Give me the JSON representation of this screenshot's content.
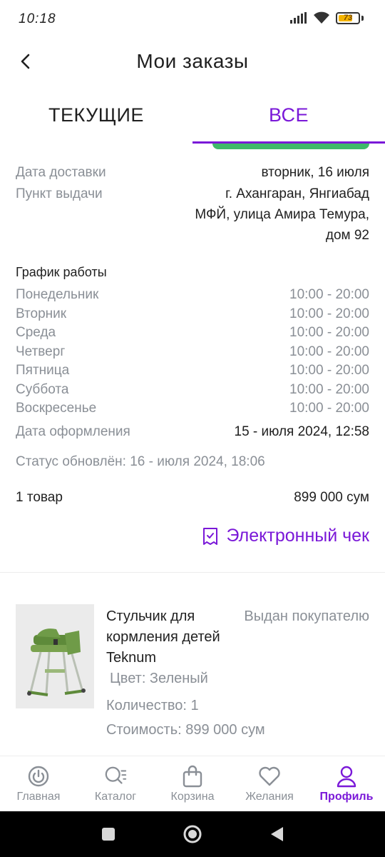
{
  "status_bar": {
    "time": "10:18",
    "battery": "73",
    "battery_level": 0.73
  },
  "header": {
    "title": "Мои заказы"
  },
  "tabs": [
    {
      "label": "ТЕКУЩИЕ",
      "active": false
    },
    {
      "label": "ВСЕ",
      "active": true
    }
  ],
  "delivery": {
    "date_label": "Дата доставки",
    "date_value": "вторник, 16 июля",
    "pickup_label": "Пункт выдачи",
    "pickup_lines": [
      "г. Ахангаран, Янгиабад",
      "МФЙ, улица Амира Темура,",
      "дом 92"
    ]
  },
  "schedule": {
    "title": "График работы",
    "days": [
      {
        "day": "Понедельник",
        "hours": "10:00 - 20:00"
      },
      {
        "day": "Вторник",
        "hours": "10:00 - 20:00"
      },
      {
        "day": "Среда",
        "hours": "10:00 - 20:00"
      },
      {
        "day": "Четверг",
        "hours": "10:00 - 20:00"
      },
      {
        "day": "Пятница",
        "hours": "10:00 - 20:00"
      },
      {
        "day": "Суббота",
        "hours": "10:00 - 20:00"
      },
      {
        "day": "Воскресенье",
        "hours": "10:00 - 20:00"
      }
    ]
  },
  "order": {
    "placed_label": "Дата оформления",
    "placed_value": "15 - июля 2024, 12:58",
    "status_updated": "Статус обновлён: 16 - июля 2024, 18:06",
    "items_count": "1 товар",
    "total": "899 000 сум",
    "receipt_label": "Электронный чек"
  },
  "product": {
    "name": "Стульчик для кормления детей Teknum",
    "status": "Выдан покупателю",
    "color": "Цвет: Зеленый",
    "quantity": "Количество: 1",
    "price": "Стоимость: 899 000 сум"
  },
  "bottom_nav": [
    {
      "label": "Главная",
      "icon": "home-power-icon",
      "active": false
    },
    {
      "label": "Каталог",
      "icon": "catalog-search-icon",
      "active": false
    },
    {
      "label": "Корзина",
      "icon": "shopping-bag-icon",
      "active": false
    },
    {
      "label": "Желания",
      "icon": "heart-icon",
      "active": false
    },
    {
      "label": "Профиль",
      "icon": "user-icon",
      "active": true
    }
  ],
  "colors": {
    "accent": "#7a18d8",
    "green": "#3fb96a",
    "muted": "#8a8f96",
    "text": "#1f1f1f"
  }
}
